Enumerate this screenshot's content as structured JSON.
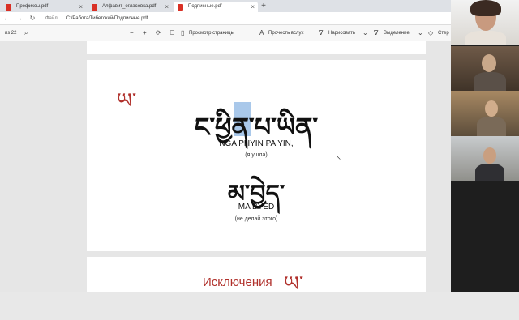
{
  "tabs": [
    {
      "title": "Префиксы.pdf"
    },
    {
      "title": "Алфавит_огласовка.pdf"
    },
    {
      "title": "Подписные.pdf"
    }
  ],
  "address": {
    "file_label": "Файл",
    "path": "C:/Работа/Тибетский/Подписные.pdf"
  },
  "toolbar": {
    "page_count": "из 22",
    "page_view": "Просмотр страницы",
    "read_aloud": "Прочесть вслух",
    "draw": "Нарисовать",
    "highlight": "Выделение",
    "erase": "Стер"
  },
  "page": {
    "letter": "ཡ་",
    "line1_tibetan": "ང་ཕྱིན་པ་ཡིན་",
    "line1_latin": "NGA PHYIN PA YIN,",
    "line1_translation": "(я ушла)",
    "line2_tibetan": "མ་བྱེད་",
    "line2_latin": "MA BYED",
    "line2_translation": "(не делай этого)"
  },
  "next_page": {
    "title": "Исключения",
    "letter": "ཡ་"
  }
}
